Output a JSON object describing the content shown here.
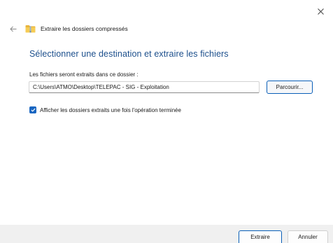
{
  "window": {
    "close_icon": "close-icon"
  },
  "header": {
    "back_icon": "back-arrow-icon",
    "folder_icon": "zip-folder-icon",
    "title": "Extraire les dossiers compressés"
  },
  "main": {
    "title": "Sélectionner une destination et extraire les fichiers",
    "title_color": "#1c4f8c",
    "path_label": "Les fichiers seront extraits dans ce dossier :",
    "path_value": "C:\\Users\\ATMO\\Desktop\\TELEPAC - SIG - Exploitation",
    "browse_label": "Parcourir...",
    "show_checkbox": {
      "checked": true,
      "label": "Afficher les dossiers extraits une fois l'opération terminée",
      "color": "#1966c1"
    }
  },
  "footer": {
    "extract_label": "Extraire",
    "cancel_label": "Annuler",
    "accent": "#0a5fb8"
  }
}
